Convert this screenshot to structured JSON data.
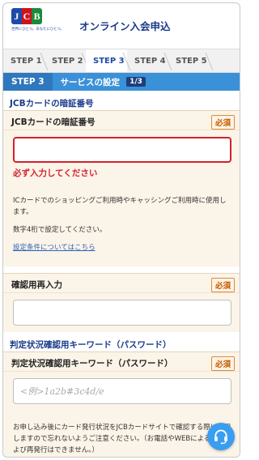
{
  "header": {
    "logo_text": [
      "J",
      "C",
      "B"
    ],
    "logo_tagline": "世界にひとつ。あなたにひとつ。",
    "title": "オンライン入会申込"
  },
  "steps": [
    "STEP 1",
    "STEP 2",
    "STEP 3",
    "STEP 4",
    "STEP 5"
  ],
  "active_step_index": 2,
  "banner": {
    "step": "STEP 3",
    "title": "サービスの設定",
    "counter": "1/3"
  },
  "pin_section": {
    "heading": "JCBカードの暗証番号",
    "field_label": "JCBカードの暗証番号",
    "required": "必須",
    "value": "",
    "error": "必ず入力してください",
    "help_1": "ICカードでのショッピングご利用時やキャッシングご利用時に使用します。",
    "help_2": "数字4桁で設定してください。",
    "link": "設定条件についてはこちら"
  },
  "confirm_field": {
    "label": "確認用再入力",
    "required": "必須",
    "value": ""
  },
  "keyword_section": {
    "heading": "判定状況確認用キーワード（パスワード）",
    "field_label": "判定状況確認用キーワード（パスワード）",
    "required": "必須",
    "placeholder": "<例>1a2b#3c4d/e",
    "note": "お申し込み後にカード発行状況をJCBカードサイトで確認する際に使用しますので忘れないようご注意ください。（お電話やWEBによる照会および再発行はできません。）"
  },
  "colors": {
    "brand_blue": "#1f4aa8",
    "banner_blue": "#3b91d8",
    "error_red": "#d4202c",
    "field_bg": "#fbf4e8",
    "chat_button": "#3a9ef0"
  },
  "icons": {
    "chat": "headset-icon"
  }
}
